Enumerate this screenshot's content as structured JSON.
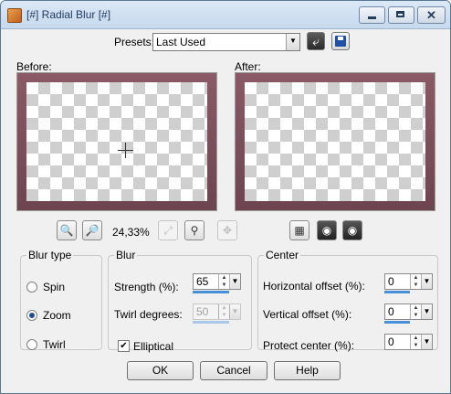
{
  "window": {
    "title": "[#] Radial Blur [#]"
  },
  "presets": {
    "label": "Presets:",
    "value": "Last Used"
  },
  "preview": {
    "before_label": "Before:",
    "after_label": "After:"
  },
  "zoom": {
    "level": "24,33%"
  },
  "blur_type": {
    "legend": "Blur type",
    "options": [
      {
        "label": "Spin",
        "selected": false
      },
      {
        "label": "Zoom",
        "selected": true
      },
      {
        "label": "Twirl",
        "selected": false
      }
    ]
  },
  "blur": {
    "legend": "Blur",
    "strength_label": "Strength (%):",
    "strength_value": "65",
    "twirl_label": "Twirl degrees:",
    "twirl_value": "50",
    "elliptical_label": "Elliptical",
    "elliptical_checked": true
  },
  "center": {
    "legend": "Center",
    "h_offset_label": "Horizontal offset (%):",
    "h_offset_value": "0",
    "v_offset_label": "Vertical offset (%):",
    "v_offset_value": "0",
    "protect_label": "Protect center (%):",
    "protect_value": "0"
  },
  "buttons": {
    "ok": "OK",
    "cancel": "Cancel",
    "help": "Help"
  },
  "colors": {
    "accent": "#4a90d9",
    "frame": "#7a4f5b"
  }
}
